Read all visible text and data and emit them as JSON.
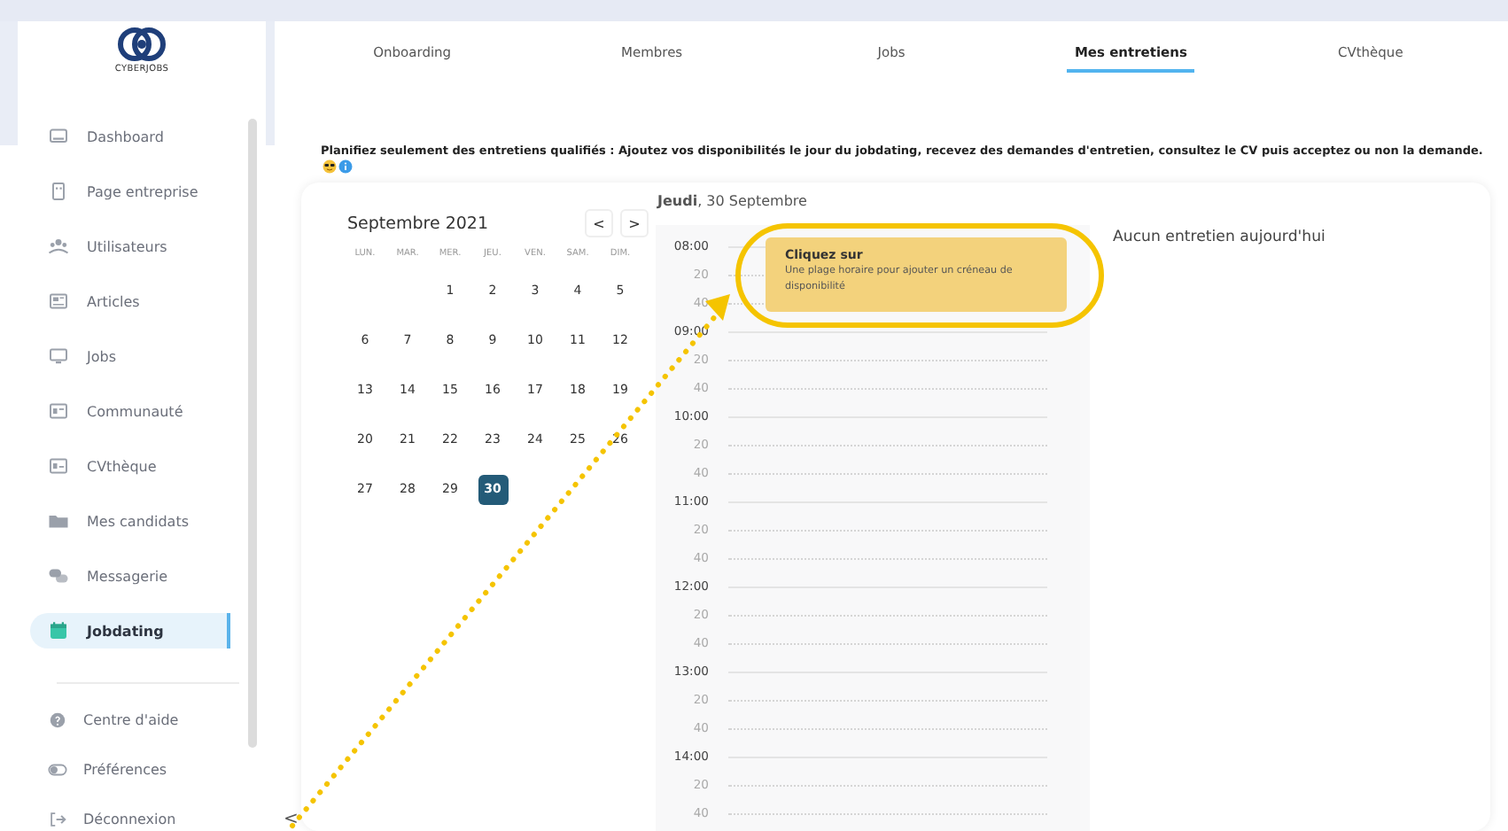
{
  "sidebar": {
    "logo_text": "CYBERJOBS",
    "items": [
      {
        "label": "Dashboard",
        "selected": false
      },
      {
        "label": "Page entreprise",
        "selected": false
      },
      {
        "label": "Utilisateurs",
        "selected": false
      },
      {
        "label": "Articles",
        "selected": false
      },
      {
        "label": "Jobs",
        "selected": false
      },
      {
        "label": "Communauté",
        "selected": false
      },
      {
        "label": "CVthèque",
        "selected": false
      },
      {
        "label": "Mes candidats",
        "selected": false
      },
      {
        "label": "Messagerie",
        "selected": false
      },
      {
        "label": "Jobdating",
        "selected": true
      }
    ],
    "footer_items": [
      {
        "label": "Centre d'aide"
      },
      {
        "label": "Préférences"
      },
      {
        "label": "Déconnexion"
      }
    ],
    "collapse_button": "<"
  },
  "tabs": [
    {
      "label": "Onboarding",
      "selected": false
    },
    {
      "label": "Membres",
      "selected": false
    },
    {
      "label": "Jobs",
      "selected": false
    },
    {
      "label": "Mes entretiens",
      "selected": true
    },
    {
      "label": "CVthèque",
      "selected": false
    }
  ],
  "description": "Planifiez seulement des entretiens qualifiés : Ajoutez vos disponibilités le jour du jobdating, recevez des demandes d'entretien, consultez le CV puis acceptez ou non la demande.",
  "calendar": {
    "month": "Septembre 2021",
    "prev": "<",
    "next": ">",
    "weekdays": [
      "LUN.",
      "MAR.",
      "MER.",
      "JEU.",
      "VEN.",
      "SAM.",
      "DIM."
    ],
    "weeks": [
      [
        {
          "label": "1",
          "selected": false
        },
        {
          "label": "2",
          "selected": false
        },
        {
          "label": "3",
          "selected": false
        },
        {
          "label": "4",
          "selected": false
        },
        {
          "label": "5",
          "selected": false
        }
      ],
      [
        {
          "label": "6",
          "selected": false
        },
        {
          "label": "7",
          "selected": false
        },
        {
          "label": "8",
          "selected": false
        },
        {
          "label": "9",
          "selected": false
        },
        {
          "label": "10",
          "selected": false
        },
        {
          "label": "11",
          "selected": false
        },
        {
          "label": "12",
          "selected": false
        }
      ],
      [
        {
          "label": "13",
          "selected": false
        },
        {
          "label": "14",
          "selected": false
        },
        {
          "label": "15",
          "selected": false
        },
        {
          "label": "16",
          "selected": false
        },
        {
          "label": "17",
          "selected": false
        },
        {
          "label": "18",
          "selected": false
        },
        {
          "label": "19",
          "selected": false
        }
      ],
      [
        {
          "label": "20",
          "selected": false
        },
        {
          "label": "21",
          "selected": false
        },
        {
          "label": "22",
          "selected": false
        },
        {
          "label": "23",
          "selected": false
        },
        {
          "label": "24",
          "selected": false
        },
        {
          "label": "25",
          "selected": false
        },
        {
          "label": "26",
          "selected": false
        }
      ],
      [
        {
          "label": "27",
          "selected": false
        },
        {
          "label": "28",
          "selected": false
        },
        {
          "label": "29",
          "selected": false
        },
        {
          "label": "30",
          "selected": true
        }
      ]
    ]
  },
  "day": {
    "heading": "**Jeudi**, 30 Septembre",
    "slots": [
      {
        "label": "08:00",
        "kind": "hour"
      },
      {
        "label": "20",
        "kind": "minute"
      },
      {
        "label": "40",
        "kind": "minute"
      },
      {
        "label": "09:00",
        "kind": "hour"
      },
      {
        "label": "20",
        "kind": "minute"
      },
      {
        "label": "40",
        "kind": "minute"
      },
      {
        "label": "10:00",
        "kind": "hour"
      },
      {
        "label": "20",
        "kind": "minute"
      },
      {
        "label": "40",
        "kind": "minute"
      },
      {
        "label": "11:00",
        "kind": "hour"
      },
      {
        "label": "20",
        "kind": "minute"
      },
      {
        "label": "40",
        "kind": "minute"
      },
      {
        "label": "12:00",
        "kind": "hour"
      },
      {
        "label": "20",
        "kind": "minute"
      },
      {
        "label": "40",
        "kind": "minute"
      },
      {
        "label": "13:00",
        "kind": "hour"
      },
      {
        "label": "20",
        "kind": "minute"
      },
      {
        "label": "40",
        "kind": "minute"
      },
      {
        "label": "14:00",
        "kind": "hour"
      },
      {
        "label": "20",
        "kind": "minute"
      },
      {
        "label": "40",
        "kind": "minute"
      }
    ],
    "hint": {
      "title": "Cliquez sur",
      "text": "Une plage horaire pour ajouter un créneau de disponibilité"
    }
  },
  "interviews": {
    "empty_message": "Aucun entretien aujourd'hui"
  }
}
